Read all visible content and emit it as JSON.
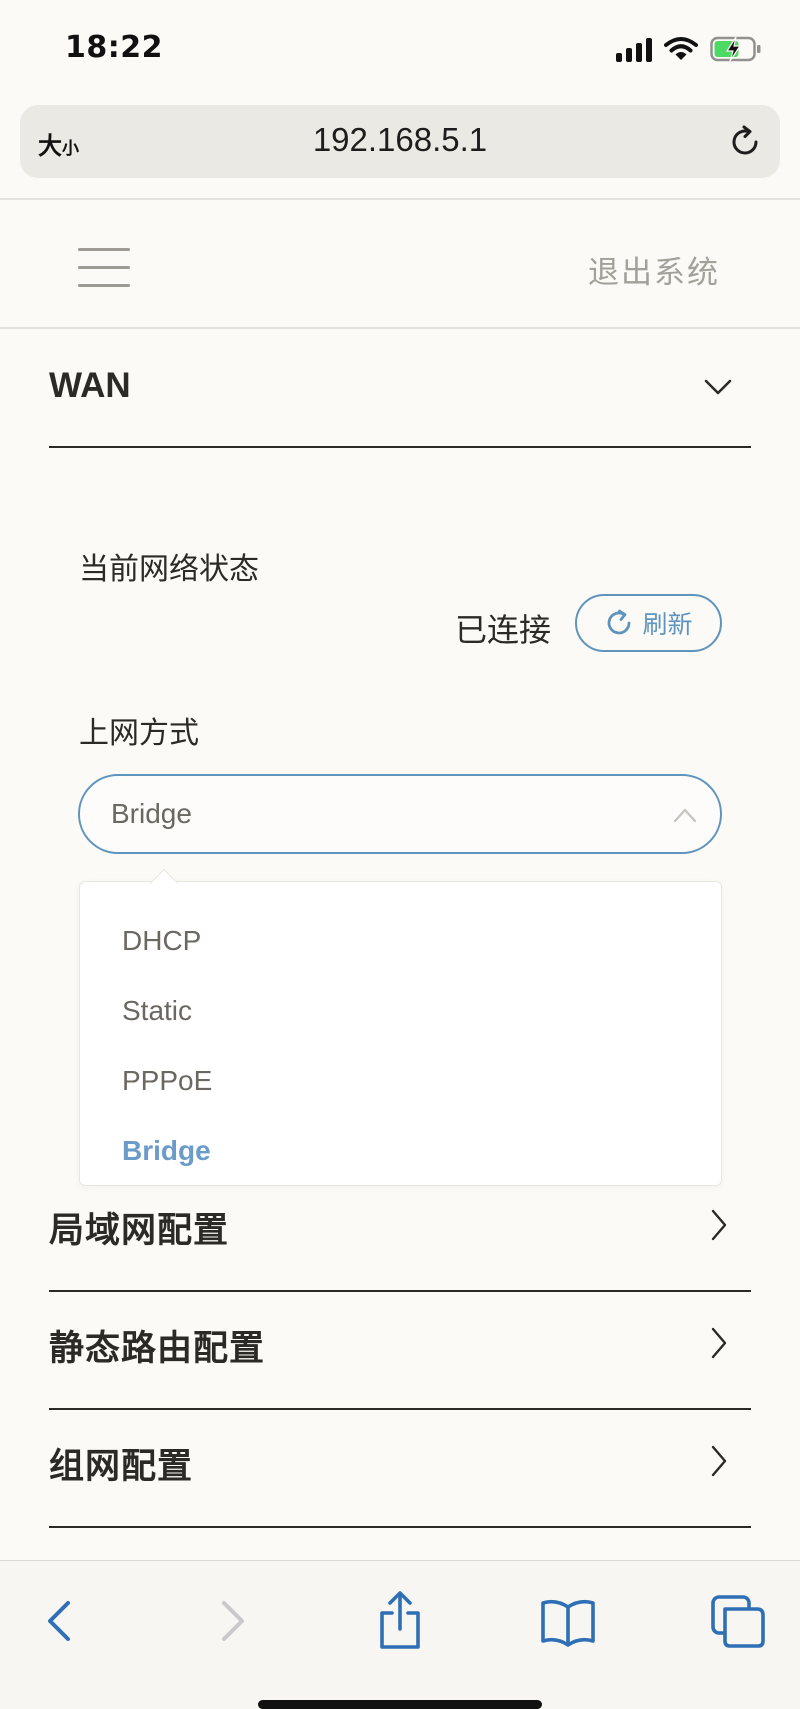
{
  "status_bar": {
    "time": "18:22",
    "icons": [
      "signal-icon",
      "wifi-icon",
      "battery-charging-icon"
    ],
    "battery_color": "#4cd964"
  },
  "browser": {
    "text_size_label_large": "大",
    "text_size_label_small": "小",
    "url": "192.168.5.1"
  },
  "header": {
    "logout": "退出系统"
  },
  "wan": {
    "title": "WAN",
    "status_label": "当前网络状态",
    "status_value": "已连接",
    "refresh_label": "刷新",
    "access_mode_label": "上网方式",
    "selected_mode": "Bridge",
    "options": [
      {
        "label": "DHCP",
        "selected": false
      },
      {
        "label": "Static",
        "selected": false
      },
      {
        "label": "PPPoE",
        "selected": false
      },
      {
        "label": "Bridge",
        "selected": true
      }
    ]
  },
  "sections": [
    {
      "label": "局域网配置"
    },
    {
      "label": "静态路由配置"
    },
    {
      "label": "组网配置"
    }
  ],
  "toolbar": {
    "icons": [
      "back-icon",
      "forward-icon",
      "share-icon",
      "bookmarks-icon",
      "tabs-icon"
    ],
    "active_color": "#2f6fb5",
    "disabled_color": "#c9c9cc"
  },
  "theme": {
    "accent": "#5f94bd",
    "selected_option": "#6a9bc9",
    "text": "#2c2a26",
    "muted": "#a3a099"
  }
}
